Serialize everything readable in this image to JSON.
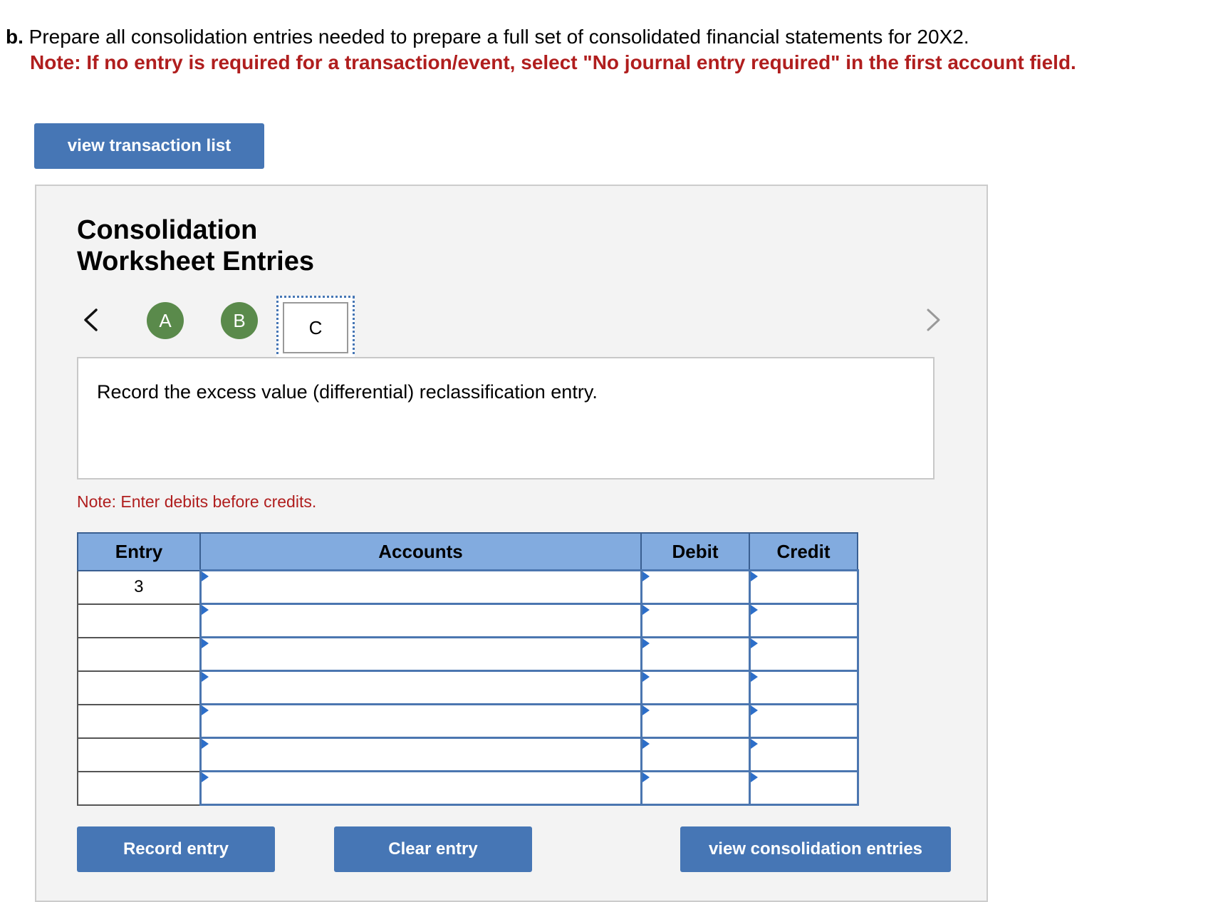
{
  "question": {
    "part_label": "b.",
    "text": "Prepare all consolidation entries needed to prepare a full set of consolidated financial statements for 20X2.",
    "note": "Note: If no entry is required for a transaction/event, select \"No journal entry required\" in the first account field."
  },
  "buttons": {
    "view_transaction_list": "view transaction list",
    "record_entry": "Record entry",
    "clear_entry": "Clear entry",
    "view_consolidation_entries": "view consolidation entries"
  },
  "panel": {
    "title": "Consolidation Worksheet Entries",
    "tabs": [
      {
        "label": "A",
        "state": "completed"
      },
      {
        "label": "B",
        "state": "completed"
      },
      {
        "label": "C",
        "state": "current"
      }
    ],
    "instruction": "Record the excess value (differential) reclassification entry.",
    "note_debits": "Note: Enter debits before credits.",
    "table": {
      "headers": {
        "entry": "Entry",
        "accounts": "Accounts",
        "debit": "Debit",
        "credit": "Credit"
      },
      "rows": [
        {
          "entry": "3",
          "account": "",
          "debit": "",
          "credit": ""
        },
        {
          "entry": "",
          "account": "",
          "debit": "",
          "credit": ""
        },
        {
          "entry": "",
          "account": "",
          "debit": "",
          "credit": ""
        },
        {
          "entry": "",
          "account": "",
          "debit": "",
          "credit": ""
        },
        {
          "entry": "",
          "account": "",
          "debit": "",
          "credit": ""
        },
        {
          "entry": "",
          "account": "",
          "debit": "",
          "credit": ""
        },
        {
          "entry": "",
          "account": "",
          "debit": "",
          "credit": ""
        }
      ]
    }
  },
  "colors": {
    "accent_button": "#4676b5",
    "note_red": "#b01e1e",
    "table_header": "#82abdf",
    "tab_completed": "#5a8a4b"
  }
}
